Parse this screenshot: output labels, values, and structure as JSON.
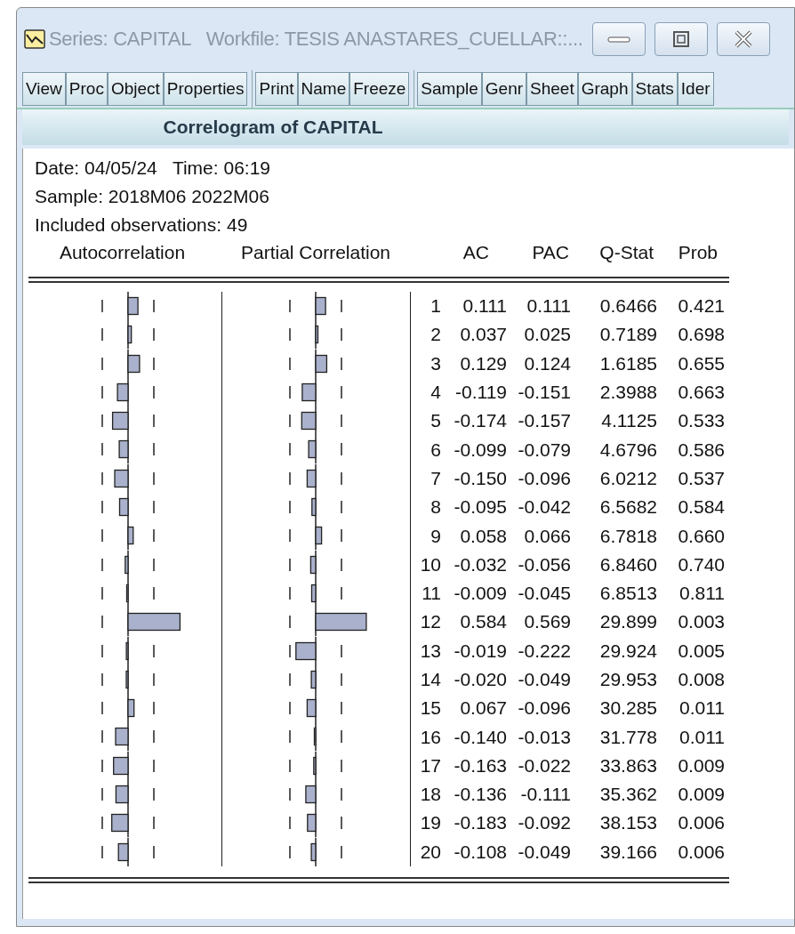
{
  "window": {
    "title": "Series: CAPITAL   Workfile: TESIS ANASTARES_CUELLAR::..."
  },
  "toolbar": [
    [
      "View",
      "Proc",
      "Object",
      "Properties"
    ],
    [
      "Print",
      "Name",
      "Freeze"
    ],
    [
      "Sample",
      "Genr",
      "Sheet",
      "Graph",
      "Stats",
      "Ider"
    ]
  ],
  "heading": "Correlogram of CAPITAL",
  "info": [
    "Date: 04/05/24   Time: 06:19",
    "Sample: 2018M06 2022M06",
    "Included observations: 49"
  ],
  "columns": [
    "Autocorrelation",
    "Partial Correlation",
    "AC",
    "PAC",
    "Q-Stat",
    "Prob"
  ],
  "rows": [
    {
      "lag": "1",
      "ac": "0.111",
      "pac": "0.111",
      "q_stat": "0.6466",
      "prob": "0.421"
    },
    {
      "lag": "2",
      "ac": "0.037",
      "pac": "0.025",
      "q_stat": "0.7189",
      "prob": "0.698"
    },
    {
      "lag": "3",
      "ac": "0.129",
      "pac": "0.124",
      "q_stat": "1.6185",
      "prob": "0.655"
    },
    {
      "lag": "4",
      "ac": "-0.119",
      "pac": "-0.151",
      "q_stat": "2.3988",
      "prob": "0.663"
    },
    {
      "lag": "5",
      "ac": "-0.174",
      "pac": "-0.157",
      "q_stat": "4.1125",
      "prob": "0.533"
    },
    {
      "lag": "6",
      "ac": "-0.099",
      "pac": "-0.079",
      "q_stat": "4.6796",
      "prob": "0.586"
    },
    {
      "lag": "7",
      "ac": "-0.150",
      "pac": "-0.096",
      "q_stat": "6.0212",
      "prob": "0.537"
    },
    {
      "lag": "8",
      "ac": "-0.095",
      "pac": "-0.042",
      "q_stat": "6.5682",
      "prob": "0.584"
    },
    {
      "lag": "9",
      "ac": "0.058",
      "pac": "0.066",
      "q_stat": "6.7818",
      "prob": "0.660"
    },
    {
      "lag": "10",
      "ac": "-0.032",
      "pac": "-0.056",
      "q_stat": "6.8460",
      "prob": "0.740"
    },
    {
      "lag": "11",
      "ac": "-0.009",
      "pac": "-0.045",
      "q_stat": "6.8513",
      "prob": "0.811"
    },
    {
      "lag": "12",
      "ac": "0.584",
      "pac": "0.569",
      "q_stat": "29.899",
      "prob": "0.003"
    },
    {
      "lag": "13",
      "ac": "-0.019",
      "pac": "-0.222",
      "q_stat": "29.924",
      "prob": "0.005"
    },
    {
      "lag": "14",
      "ac": "-0.020",
      "pac": "-0.049",
      "q_stat": "29.953",
      "prob": "0.008"
    },
    {
      "lag": "15",
      "ac": "0.067",
      "pac": "-0.096",
      "q_stat": "30.285",
      "prob": "0.011"
    },
    {
      "lag": "16",
      "ac": "-0.140",
      "pac": "-0.013",
      "q_stat": "31.778",
      "prob": "0.011"
    },
    {
      "lag": "17",
      "ac": "-0.163",
      "pac": "-0.022",
      "q_stat": "33.863",
      "prob": "0.009"
    },
    {
      "lag": "18",
      "ac": "-0.136",
      "pac": "-0.111",
      "q_stat": "35.362",
      "prob": "0.009"
    },
    {
      "lag": "19",
      "ac": "-0.183",
      "pac": "-0.092",
      "q_stat": "38.153",
      "prob": "0.006"
    },
    {
      "lag": "20",
      "ac": "-0.108",
      "pac": "-0.049",
      "q_stat": "39.166",
      "prob": "0.006"
    }
  ]
}
